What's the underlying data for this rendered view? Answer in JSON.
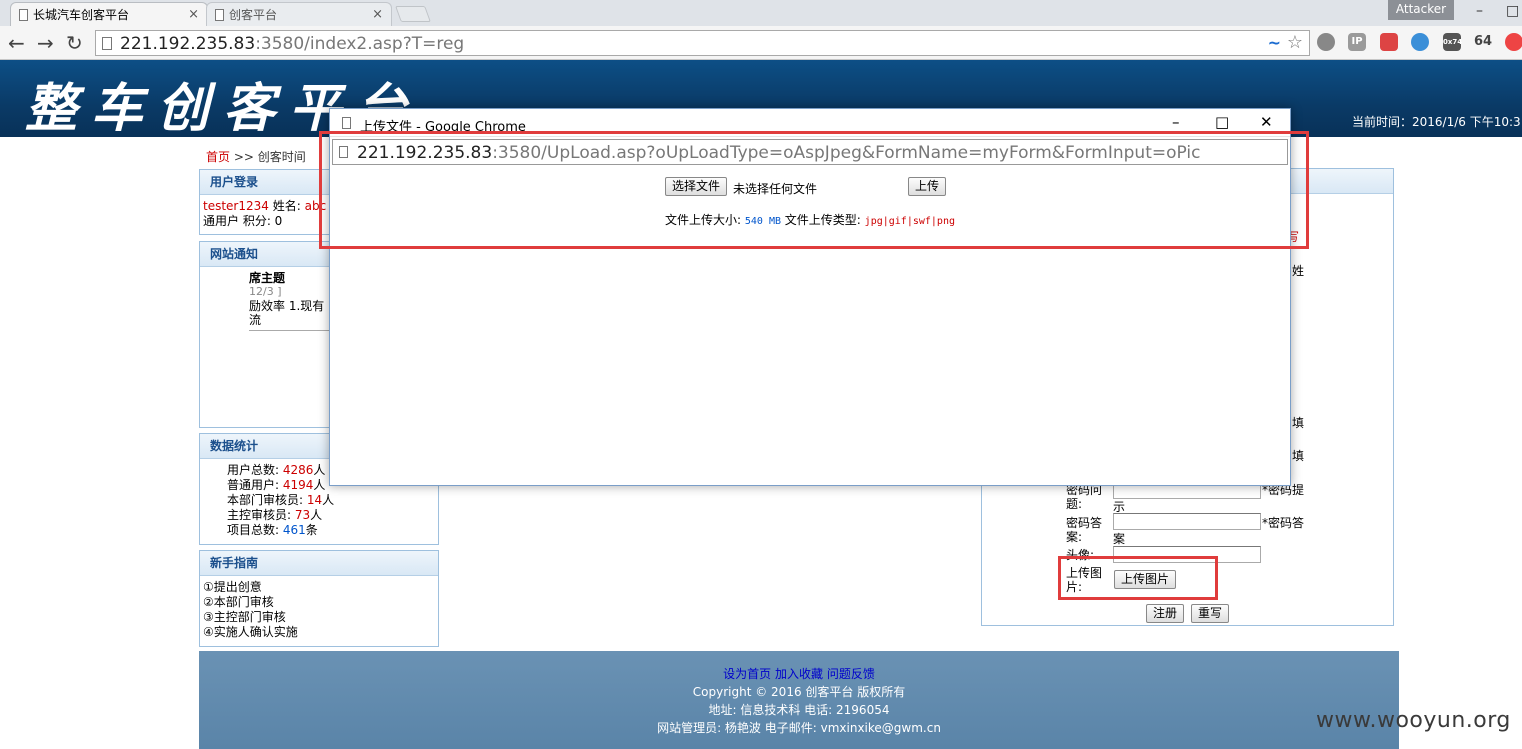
{
  "browser": {
    "tabs": [
      {
        "label": "长城汽车创客平台",
        "close": "×"
      },
      {
        "label": "创客平台",
        "close": "×"
      }
    ],
    "profile_label": "Attacker",
    "window_controls": {
      "minimize": "–",
      "maximize": "□",
      "close": "✕"
    },
    "nav": {
      "back": "←",
      "forward": "→",
      "reload": "↻"
    },
    "url_host": "221.192.235.83",
    "url_rest": ":3580/index2.asp?T=reg",
    "extension_labels": [
      "IP",
      "0x74",
      "64"
    ]
  },
  "site": {
    "title": "整车创客平台",
    "current_time": "当前时间：2016/1/6 下午10:3",
    "breadcrumb": {
      "home": "首页",
      "sep": " >> ",
      "current": "创客时间"
    },
    "login_panel": {
      "title": "用户登录",
      "username": "tester1234",
      "name_label": "姓名:",
      "name_value": "abc",
      "line2": "通用户 积分: 0"
    },
    "notice_panel": {
      "title": "网站通知",
      "heading": "席主题",
      "date": "12/3 ]",
      "text": "励效率 1.现有流"
    },
    "stats_panel": {
      "title": "数据统计",
      "rows": [
        {
          "label": "用户总数: ",
          "value": "4286",
          "unit": "人",
          "color": "red"
        },
        {
          "label": "普通用户: ",
          "value": "4194",
          "unit": "人",
          "color": "red"
        },
        {
          "label": "本部门审核员: ",
          "value": "14",
          "unit": "人",
          "color": "red"
        },
        {
          "label": "主控审核员: ",
          "value": "73",
          "unit": "人",
          "color": "red"
        },
        {
          "label": "项目总数: ",
          "value": "461",
          "unit": "条",
          "color": "blue"
        }
      ]
    },
    "guide_panel": {
      "title": "新手指南",
      "items": [
        "①提出创意",
        "②本部门审核",
        "③主控部门审核",
        "④实施人确认实施"
      ]
    },
    "reg_form": {
      "right_frag_1": "写",
      "right_frag_2": "姓",
      "right_frag_3": "填",
      "right_frag_4": "填",
      "pwd_question_label_1": "密码问",
      "pwd_question_label_2": "题:",
      "pwd_question_hint_1": "*密码提",
      "pwd_question_hint_2": "示",
      "pwd_answer_label_1": "密码答",
      "pwd_answer_label_2": "案:",
      "pwd_answer_hint_1": "*密码答",
      "pwd_answer_hint_2": "案",
      "avatar_label": "头像:",
      "upload_label_1": "上传图",
      "upload_label_2": "片:",
      "upload_button": "上传图片",
      "submit_button": "注册",
      "reset_button": "重写"
    },
    "footer": {
      "links": [
        "设为首页",
        "加入收藏",
        "问题反馈"
      ],
      "copyright": "Copyright © 2016  创客平台  版权所有",
      "address": "地址:  信息技术科  电话: 2196054",
      "admin": "网站管理员: 杨艳波  电子邮件: vmxinxike@gwm.cn"
    },
    "watermark": "www.wooyun.org"
  },
  "popup": {
    "window_title": "上传文件 - Google Chrome",
    "url_host": "221.192.235.83",
    "url_rest": ":3580/UpLoad.asp?oUpLoadType=oAspJpeg&FormName=myForm&FormInput=oPic",
    "choose_button": "选择文件",
    "no_file_text": "未选择任何文件",
    "upload_button": "上传",
    "size_label": "文件上传大小: ",
    "size_value": "540 MB",
    "type_label": " 文件上传类型: ",
    "type_value": "jpg|gif|swf|png"
  },
  "colors": {
    "highlight": "#e03c3c",
    "banner": "#0a3a66",
    "link_red": "#cc0000"
  }
}
